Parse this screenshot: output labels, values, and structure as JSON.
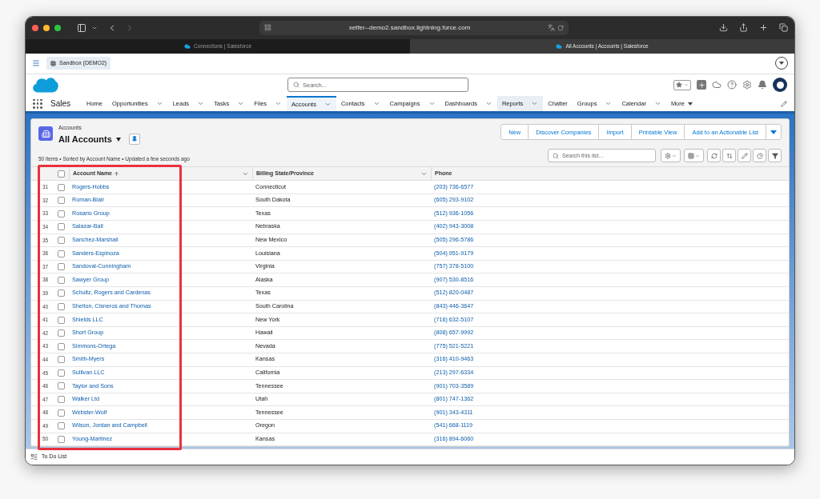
{
  "browser": {
    "url": "xetfer--demo2.sandbox.lightning.force.com",
    "tabs": [
      {
        "title": "Connections | Salesforce",
        "selected": false
      },
      {
        "title": "All Accounts | Accounts | Salesforce",
        "selected": true
      }
    ]
  },
  "org_badge": "Sandbox (DEMO2)",
  "search": {
    "placeholder": "Search..."
  },
  "app_name": "Sales",
  "nav": [
    {
      "label": "Home",
      "kind": "plain",
      "selected": false,
      "highlighted": false
    },
    {
      "label": "Opportunities",
      "kind": "menu",
      "selected": false,
      "highlighted": false
    },
    {
      "label": "Leads",
      "kind": "menu",
      "selected": false,
      "highlighted": false
    },
    {
      "label": "Tasks",
      "kind": "menu",
      "selected": false,
      "highlighted": false
    },
    {
      "label": "Files",
      "kind": "menu",
      "selected": false,
      "highlighted": false
    },
    {
      "label": "Accounts",
      "kind": "menu",
      "selected": true,
      "highlighted": false
    },
    {
      "label": "Contacts",
      "kind": "menu",
      "selected": false,
      "highlighted": false
    },
    {
      "label": "Campaigns",
      "kind": "menu",
      "selected": false,
      "highlighted": false
    },
    {
      "label": "Dashboards",
      "kind": "menu",
      "selected": false,
      "highlighted": false
    },
    {
      "label": "Reports",
      "kind": "menu",
      "selected": false,
      "highlighted": true
    },
    {
      "label": "Chatter",
      "kind": "plain",
      "selected": false,
      "highlighted": false
    },
    {
      "label": "Groups",
      "kind": "menu",
      "selected": false,
      "highlighted": false
    },
    {
      "label": "Calendar",
      "kind": "menu",
      "selected": false,
      "highlighted": false
    },
    {
      "label": "More",
      "kind": "more",
      "selected": false,
      "highlighted": false
    }
  ],
  "list_view": {
    "object": "Accounts",
    "view": "All Accounts",
    "status": "50 items • Sorted by Account Name • Updated a few seconds ago",
    "buttons": [
      "New",
      "Discover Companies",
      "Import",
      "Printable View",
      "Add to an Actionable List"
    ],
    "search_placeholder": "Search this list...",
    "select_all_checked": false,
    "columns": [
      {
        "label": "Account Name",
        "sorted": true
      },
      {
        "label": "Billing State/Province",
        "sorted": false
      },
      {
        "label": "Phone",
        "sorted": false
      }
    ],
    "rows": [
      {
        "number": "31",
        "name": "Rogers-Hobbs",
        "state": "Connecticut",
        "phone": "(203) 736-6577",
        "checked": false
      },
      {
        "number": "32",
        "name": "Roman-Blair",
        "state": "South Dakota",
        "phone": "(605) 293-9102",
        "checked": false
      },
      {
        "number": "33",
        "name": "Rosario Group",
        "state": "Texas",
        "phone": "(512) 936-1056",
        "checked": false
      },
      {
        "number": "34",
        "name": "Salazar-Ball",
        "state": "Nebraska",
        "phone": "(402) 943-3008",
        "checked": false
      },
      {
        "number": "35",
        "name": "Sanchez-Marshall",
        "state": "New Mexico",
        "phone": "(505) 296-5786",
        "checked": false
      },
      {
        "number": "36",
        "name": "Sanders-Espinoza",
        "state": "Louisiana",
        "phone": "(504) 951-9179",
        "checked": false
      },
      {
        "number": "37",
        "name": "Sandoval-Cunningham",
        "state": "Virginia",
        "phone": "(757) 378-5100",
        "checked": false
      },
      {
        "number": "38",
        "name": "Sawyer Group",
        "state": "Alaska",
        "phone": "(907) 530-8516",
        "checked": false
      },
      {
        "number": "39",
        "name": "Schultz, Rogers and Cardenas",
        "state": "Texas",
        "phone": "(512) 820-0487",
        "checked": false
      },
      {
        "number": "40",
        "name": "Shelton, Cisneros and Thomas",
        "state": "South Carolina",
        "phone": "(843) 446-3647",
        "checked": false
      },
      {
        "number": "41",
        "name": "Shields LLC",
        "state": "New York",
        "phone": "(716) 632-5107",
        "checked": false
      },
      {
        "number": "42",
        "name": "Short Group",
        "state": "Hawaii",
        "phone": "(808) 657-9992",
        "checked": false
      },
      {
        "number": "43",
        "name": "Simmons-Ortega",
        "state": "Nevada",
        "phone": "(775) 521-5221",
        "checked": false
      },
      {
        "number": "44",
        "name": "Smith-Myers",
        "state": "Kansas",
        "phone": "(316) 410-9463",
        "checked": false
      },
      {
        "number": "45",
        "name": "Sullivan LLC",
        "state": "California",
        "phone": "(213) 297-6334",
        "checked": false
      },
      {
        "number": "46",
        "name": "Taylor and Sons",
        "state": "Tennessee",
        "phone": "(901) 703-3589",
        "checked": false
      },
      {
        "number": "47",
        "name": "Walker Ltd",
        "state": "Utah",
        "phone": "(801) 747-1362",
        "checked": false
      },
      {
        "number": "48",
        "name": "Webster-Wolf",
        "state": "Tennessee",
        "phone": "(901) 343-4311",
        "checked": false
      },
      {
        "number": "49",
        "name": "Wilson, Jordan and Campbell",
        "state": "Oregon",
        "phone": "(541) 668-1119",
        "checked": false
      },
      {
        "number": "50",
        "name": "Young-Martinez",
        "state": "Kansas",
        "phone": "(316) 894-6060",
        "checked": false
      }
    ]
  },
  "footer": {
    "label": "To Do List"
  }
}
